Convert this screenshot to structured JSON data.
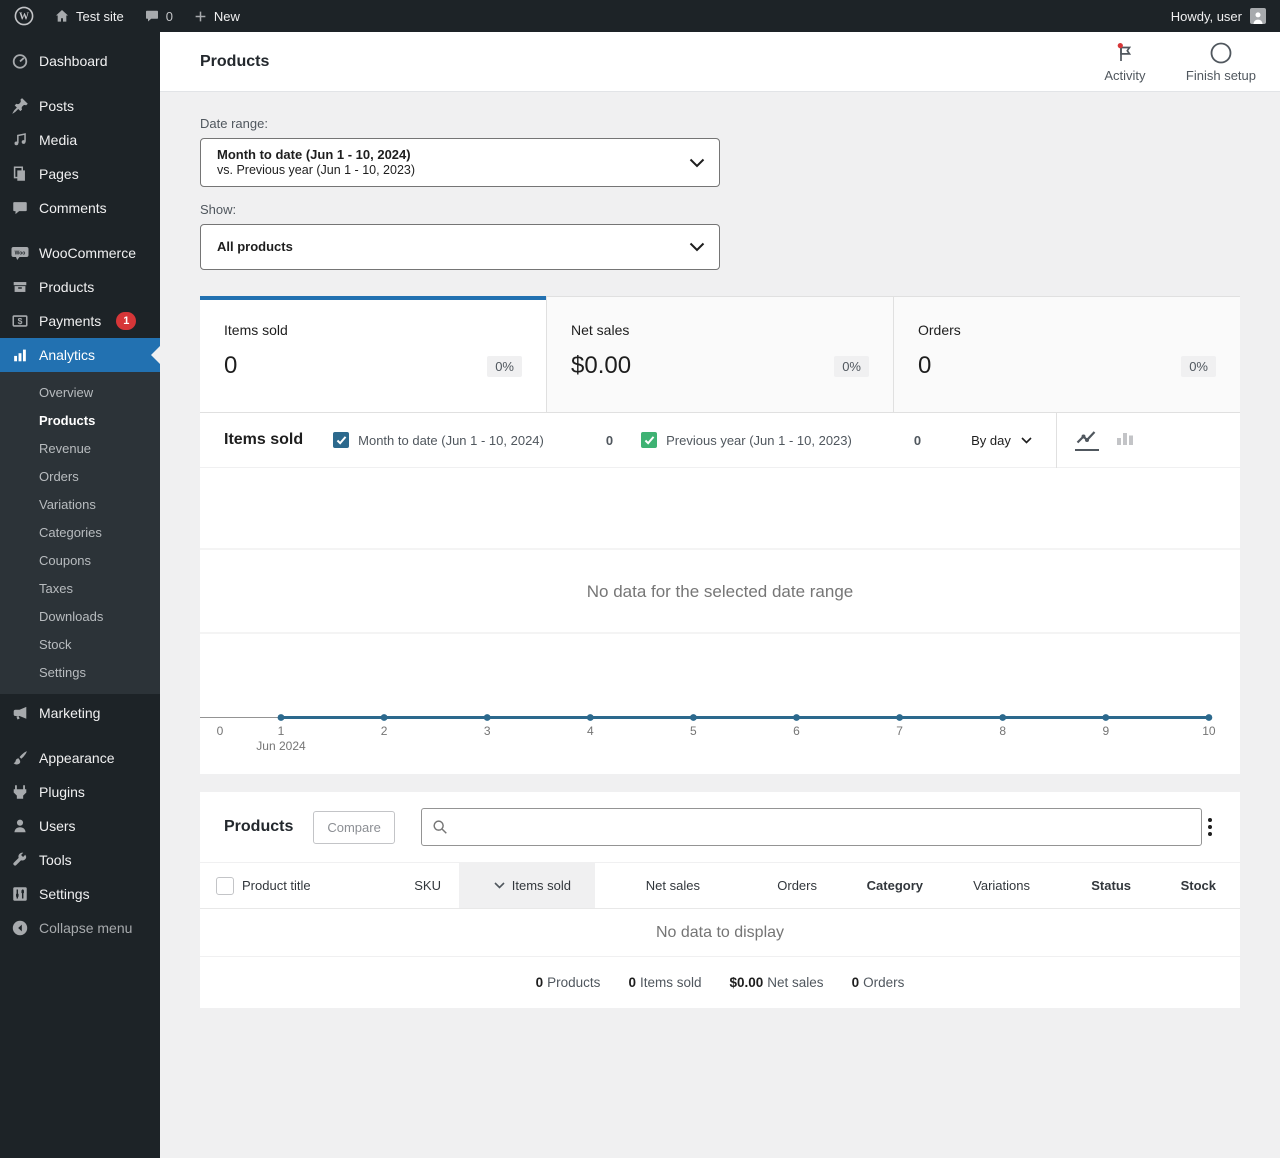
{
  "admin_bar": {
    "site_name": "Test site",
    "comments_count": "0",
    "new_label": "New",
    "howdy": "Howdy, user"
  },
  "sidebar": {
    "items": [
      {
        "label": "Dashboard"
      },
      {
        "label": "Posts"
      },
      {
        "label": "Media"
      },
      {
        "label": "Pages"
      },
      {
        "label": "Comments"
      },
      {
        "label": "WooCommerce"
      },
      {
        "label": "Products"
      },
      {
        "label": "Payments"
      },
      {
        "label": "Analytics"
      },
      {
        "label": "Marketing"
      },
      {
        "label": "Appearance"
      },
      {
        "label": "Plugins"
      },
      {
        "label": "Users"
      },
      {
        "label": "Tools"
      },
      {
        "label": "Settings"
      },
      {
        "label": "Collapse menu"
      }
    ],
    "payments_badge": "1",
    "submenu": [
      {
        "label": "Overview"
      },
      {
        "label": "Products"
      },
      {
        "label": "Revenue"
      },
      {
        "label": "Orders"
      },
      {
        "label": "Variations"
      },
      {
        "label": "Categories"
      },
      {
        "label": "Coupons"
      },
      {
        "label": "Taxes"
      },
      {
        "label": "Downloads"
      },
      {
        "label": "Stock"
      },
      {
        "label": "Settings"
      }
    ]
  },
  "header": {
    "title": "Products",
    "activity_label": "Activity",
    "finish_setup_label": "Finish setup"
  },
  "filters": {
    "date_range_label": "Date range:",
    "date_range_primary": "Month to date (Jun 1 - 10, 2024)",
    "date_range_secondary": "vs. Previous year (Jun 1 - 10, 2023)",
    "show_label": "Show:",
    "show_value": "All products"
  },
  "stats": {
    "tabs": [
      {
        "label": "Items sold",
        "value": "0",
        "change": "0%"
      },
      {
        "label": "Net sales",
        "value": "$0.00",
        "change": "0%"
      },
      {
        "label": "Orders",
        "value": "0",
        "change": "0%"
      }
    ]
  },
  "chart": {
    "title": "Items sold",
    "legend": [
      {
        "label": "Month to date (Jun 1 - 10, 2024)",
        "value": "0",
        "color": "#2c698d",
        "checked": true
      },
      {
        "label": "Previous year (Jun 1 - 10, 2023)",
        "value": "0",
        "color": "#3eb273",
        "checked": true
      }
    ],
    "interval": "By day",
    "empty_message": "No data for the selected date range"
  },
  "chart_data": {
    "type": "line",
    "title": "Items sold",
    "xlabel": "",
    "ylabel": "Items sold",
    "ylim": [
      0,
      1
    ],
    "grid": true,
    "x_ticks": [
      "0",
      "1",
      "2",
      "3",
      "4",
      "5",
      "6",
      "7",
      "8",
      "9",
      "10"
    ],
    "x_axis_note": {
      "tick": "1",
      "label": "Jun 2024"
    },
    "series": [
      {
        "name": "Month to date (Jun 1 - 10, 2024)",
        "color": "#2c698d",
        "x": [
          1,
          2,
          3,
          4,
          5,
          6,
          7,
          8,
          9,
          10
        ],
        "values": [
          0,
          0,
          0,
          0,
          0,
          0,
          0,
          0,
          0,
          0
        ]
      },
      {
        "name": "Previous year (Jun 1 - 10, 2023)",
        "color": "#3eb273",
        "x": [
          1,
          2,
          3,
          4,
          5,
          6,
          7,
          8,
          9,
          10
        ],
        "values": [
          0,
          0,
          0,
          0,
          0,
          0,
          0,
          0,
          0,
          0
        ]
      }
    ]
  },
  "products_table": {
    "title": "Products",
    "compare_label": "Compare",
    "search_value": "",
    "columns": [
      {
        "label": "Product title"
      },
      {
        "label": "SKU"
      },
      {
        "label": "Items sold",
        "sorted": "desc"
      },
      {
        "label": "Net sales"
      },
      {
        "label": "Orders"
      },
      {
        "label": "Category"
      },
      {
        "label": "Variations"
      },
      {
        "label": "Status"
      },
      {
        "label": "Stock"
      }
    ],
    "empty_message": "No data to display",
    "summary": [
      {
        "value": "0",
        "label": "Products"
      },
      {
        "value": "0",
        "label": "Items sold"
      },
      {
        "value": "$0.00",
        "label": "Net sales"
      },
      {
        "value": "0",
        "label": "Orders"
      }
    ]
  },
  "colors": {
    "accent_blue": "#2271b1",
    "badge_red": "#d63638",
    "series_primary": "#2c698d",
    "series_secondary": "#3eb273"
  }
}
